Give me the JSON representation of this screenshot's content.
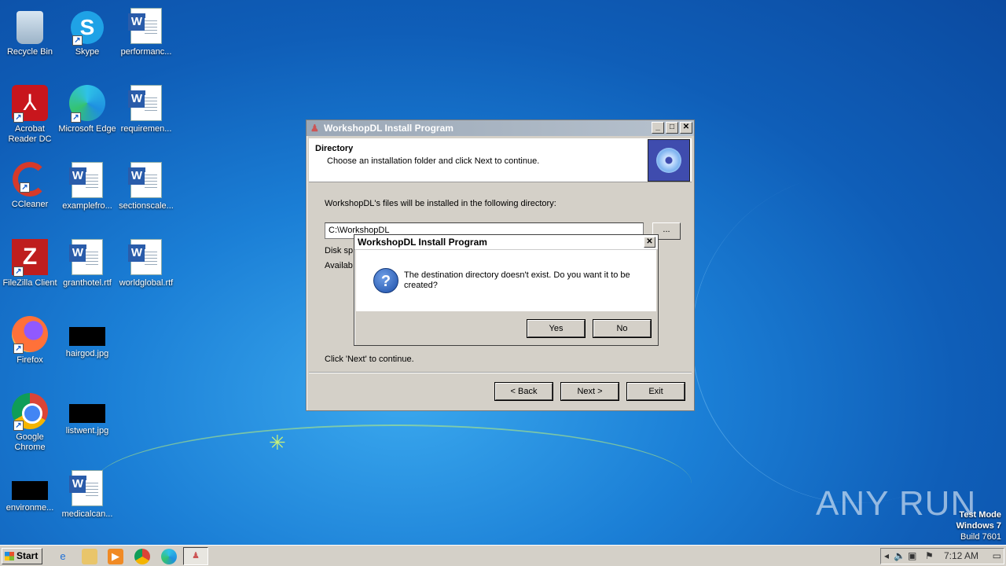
{
  "desktop": {
    "icons": [
      {
        "label": "Recycle Bin"
      },
      {
        "label": "Skype"
      },
      {
        "label": "performanc..."
      },
      {
        "label": "Acrobat Reader DC"
      },
      {
        "label": "Microsoft Edge"
      },
      {
        "label": "requiremen..."
      },
      {
        "label": "CCleaner"
      },
      {
        "label": "examplefro..."
      },
      {
        "label": "sectionscale..."
      },
      {
        "label": "FileZilla Client"
      },
      {
        "label": "granthotel.rtf"
      },
      {
        "label": "worldglobal.rtf"
      },
      {
        "label": "Firefox"
      },
      {
        "label": "hairgod.jpg"
      },
      {
        "label": "Google Chrome"
      },
      {
        "label": "listwent.jpg"
      },
      {
        "label": "environme..."
      },
      {
        "label": "medicalcan..."
      }
    ],
    "watermark": "ANY RUN",
    "test_mode": {
      "line1": "Test Mode",
      "line2": "Windows 7",
      "line3": "Build 7601"
    }
  },
  "installer": {
    "title": "WorkshopDL Install Program",
    "header_title": "Directory",
    "header_subtitle": "Choose an installation folder and click Next to continue.",
    "body_text": "WorkshopDL's files will be installed in the following directory:",
    "directory_value": "C:\\WorkshopDL",
    "browse_label": "...",
    "disk_space_label": "Disk sp",
    "available_label": "Availab",
    "continue_text": "Click 'Next' to continue.",
    "back_label": "< Back",
    "next_label": "Next >",
    "exit_label": "Exit"
  },
  "dialog": {
    "title": "WorkshopDL Install Program",
    "message": "The destination directory doesn't exist. Do you want it to be created?",
    "yes_label": "Yes",
    "no_label": "No"
  },
  "taskbar": {
    "start_label": "Start",
    "clock": "7:12 AM"
  }
}
